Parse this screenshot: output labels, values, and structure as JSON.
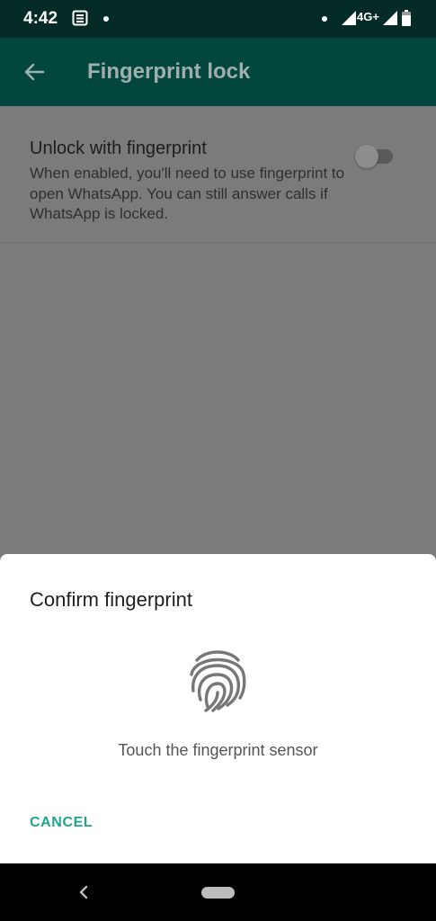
{
  "status_bar": {
    "time": "4:42",
    "network_type": "4G+",
    "icons": [
      "news-icon",
      "notification-dot-icon",
      "signal-icon",
      "battery-icon"
    ]
  },
  "app_bar": {
    "title": "Fingerprint lock",
    "back_icon": "back-arrow-icon"
  },
  "setting": {
    "title": "Unlock with fingerprint",
    "description": "When enabled, you'll need to use fingerprint to open WhatsApp. You can still answer calls if WhatsApp is locked.",
    "toggle_on": false
  },
  "dialog": {
    "title": "Confirm fingerprint",
    "icon": "fingerprint-icon",
    "message": "Touch the fingerprint sensor",
    "cancel_label": "CANCEL"
  },
  "colors": {
    "app_bar": "#03463e",
    "status_bar": "#042b26",
    "accent": "#1fa58d",
    "scrim": "#7a7a7a"
  }
}
